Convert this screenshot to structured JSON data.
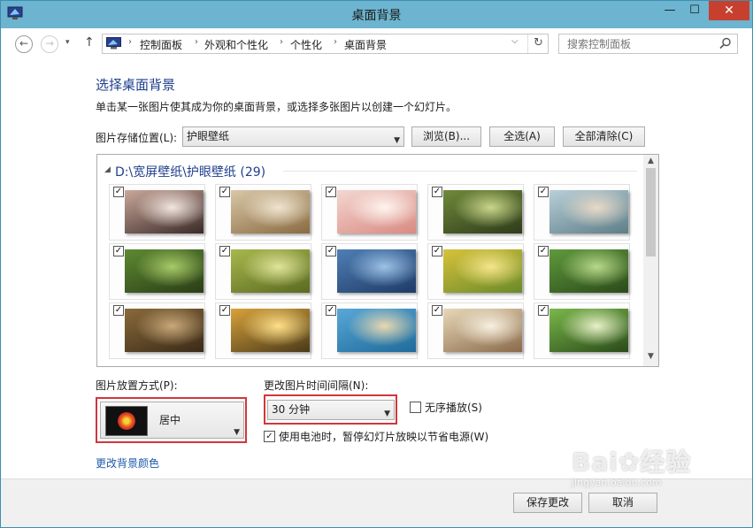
{
  "window": {
    "title": "桌面背景",
    "minimize_glyph": "—",
    "maximize_glyph": "☐",
    "close_glyph": "✕"
  },
  "nav": {
    "back_glyph": "←",
    "forward_glyph": "→",
    "history_glyph": "▾",
    "up_glyph": "↑",
    "breadcrumbs": [
      "控制面板",
      "外观和个性化",
      "个性化",
      "桌面背景"
    ],
    "separator": "›",
    "dropdown_glyph": "⌵",
    "refresh_glyph": "↻",
    "search_placeholder": "搜索控制面板"
  },
  "content": {
    "heading": "选择桌面背景",
    "description": "单击某一张图片使其成为你的桌面背景，或选择多张图片以创建一个幻灯片。",
    "location_label": "图片存储位置(L):",
    "location_value": "护眼壁纸",
    "browse_label": "浏览(B)...",
    "select_all_label": "全选(A)",
    "clear_all_label": "全部清除(C)",
    "group_title": "D:\\宽屏壁纸\\护眼壁纸 (29)",
    "group_glyph": "◢",
    "thumbnails": [
      {
        "checked": "✓",
        "colors": [
          "#c9a89a",
          "#3a2a28",
          "#f2e6e0"
        ]
      },
      {
        "checked": "✓",
        "colors": [
          "#d8c7a8",
          "#8a6b40",
          "#efe4d0"
        ]
      },
      {
        "checked": "✓",
        "colors": [
          "#f3d7d1",
          "#d98a82",
          "#fff4ef"
        ]
      },
      {
        "checked": "✓",
        "colors": [
          "#6f8a3a",
          "#2f3b1c",
          "#c9d68a"
        ]
      },
      {
        "checked": "✓",
        "colors": [
          "#b9cfd8",
          "#5d7e88",
          "#e8d9c7"
        ]
      },
      {
        "checked": "✓",
        "colors": [
          "#5e8a32",
          "#2a3d16",
          "#a8c968"
        ]
      },
      {
        "checked": "✓",
        "colors": [
          "#a8b84c",
          "#5a6a22",
          "#e0e49a"
        ]
      },
      {
        "checked": "✓",
        "colors": [
          "#4f7fb6",
          "#1f3b66",
          "#9cc2e6"
        ]
      },
      {
        "checked": "✓",
        "colors": [
          "#d8c23a",
          "#6a8a2a",
          "#f4e58a"
        ]
      },
      {
        "checked": "✓",
        "colors": [
          "#5f9a3c",
          "#2b4a1a",
          "#b8d88a"
        ]
      },
      {
        "checked": "✓",
        "colors": [
          "#8a6a3a",
          "#3a2a18",
          "#c8a87a"
        ]
      },
      {
        "checked": "✓",
        "colors": [
          "#d8a23a",
          "#4a3a1a",
          "#ffe08a"
        ]
      },
      {
        "checked": "✓",
        "colors": [
          "#58a8d8",
          "#1f6a9a",
          "#e8d8b0"
        ]
      },
      {
        "checked": "✓",
        "colors": [
          "#e8d8b8",
          "#8a6a4a",
          "#f8f0e0"
        ]
      },
      {
        "checked": "✓",
        "colors": [
          "#7ab84a",
          "#2a4a1a",
          "#e8f0c8"
        ]
      }
    ],
    "scroll_up_glyph": "▲",
    "scroll_down_glyph": "▼",
    "position_label": "图片放置方式(P):",
    "position_value": "居中",
    "interval_label": "更改图片时间间隔(N):",
    "interval_value": "30 分钟",
    "select_arrow_glyph": "▼",
    "shuffle_label": "无序播放(S)",
    "shuffle_checked": "",
    "battery_label": "使用电池时，暂停幻灯片放映以节省电源(W)",
    "battery_checked": "✓",
    "change_color_link": "更改背景颜色"
  },
  "footer": {
    "save_label": "保存更改",
    "cancel_label": "取消"
  },
  "watermark": {
    "main": "Bai✿经验",
    "sub": "jingyan.baidu.com"
  },
  "colors": {
    "titlebar": "#6cb4cf",
    "heading_blue": "#1e3f8c",
    "highlight_red": "#d2363a",
    "link_blue": "#1e5aa8"
  }
}
